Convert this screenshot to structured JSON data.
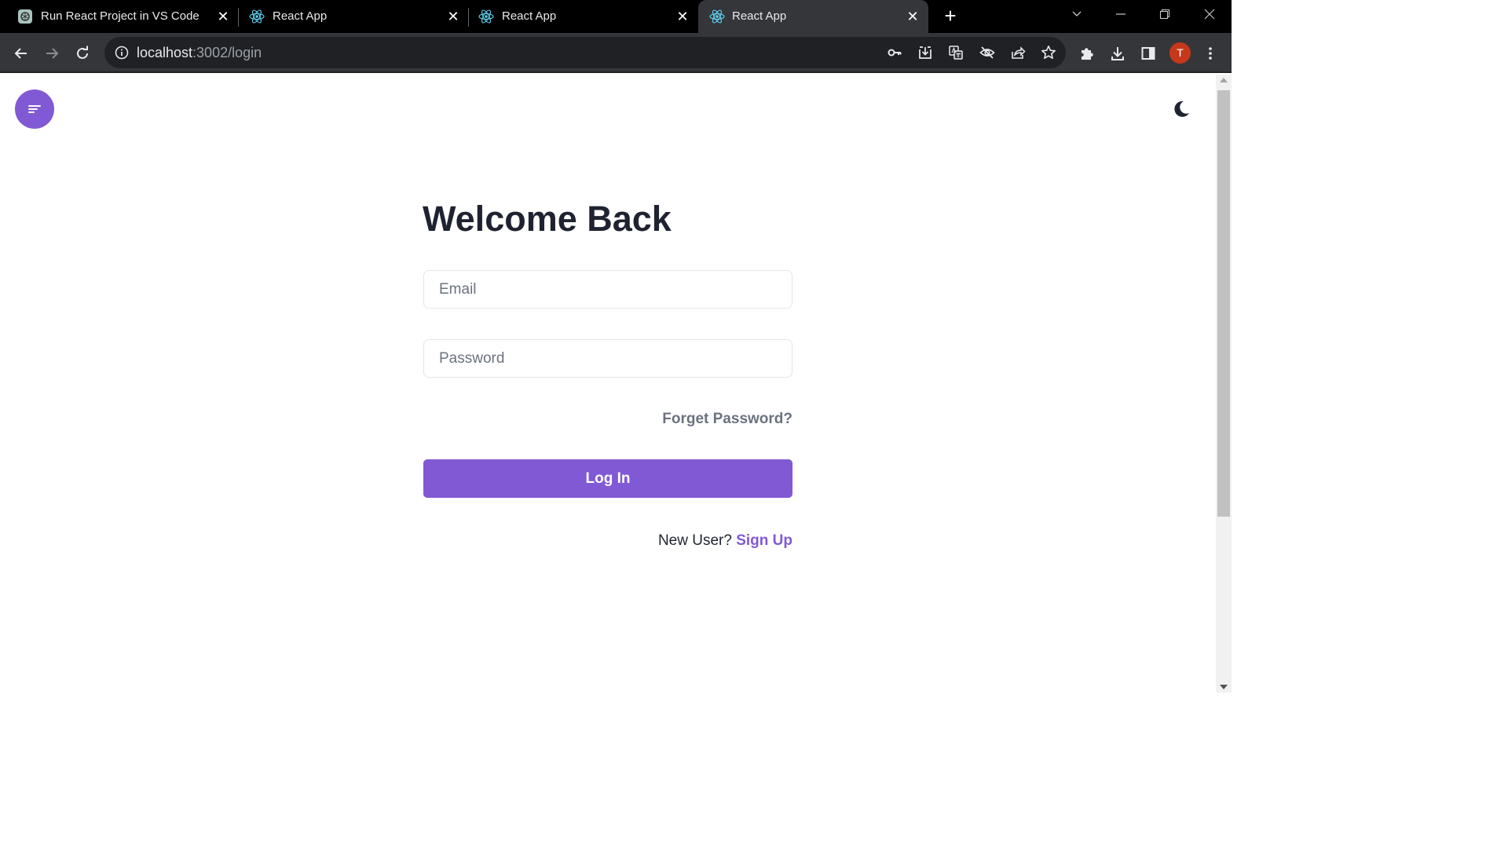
{
  "browser": {
    "tabs": [
      {
        "title": "Run React Project in VS Code",
        "icon": "chatgpt-icon",
        "active": false
      },
      {
        "title": "React App",
        "icon": "react-icon",
        "active": false
      },
      {
        "title": "React App",
        "icon": "react-icon",
        "active": false
      },
      {
        "title": "React App",
        "icon": "react-icon",
        "active": true
      }
    ],
    "url_host": "localhost",
    "url_rest": ":3002/login",
    "profile_initial": "T"
  },
  "login": {
    "heading": "Welcome Back",
    "email_placeholder": "Email",
    "password_placeholder": "Password",
    "forgot_label": "Forget Password?",
    "login_label": "Log In",
    "new_user_text": "New User?",
    "signup_label": "Sign Up"
  },
  "colors": {
    "accent": "#8259d4",
    "heading": "#1f2331",
    "muted": "#6b7280"
  }
}
